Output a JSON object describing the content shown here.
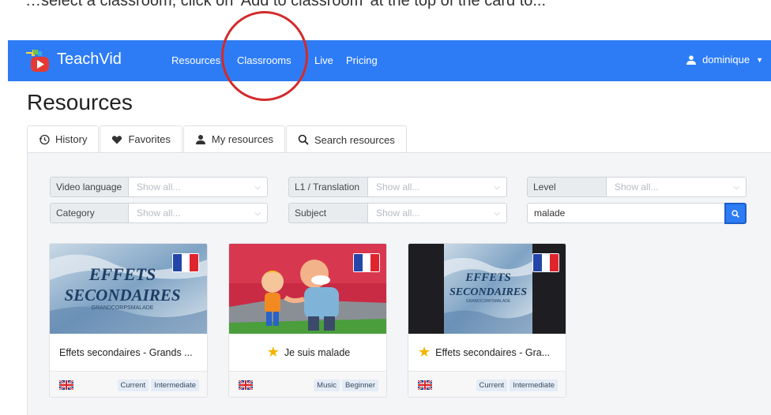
{
  "caption": "…select a classroom, click on 'Add to classroom' at the top of the card to...",
  "app": {
    "name": "TeachVid"
  },
  "nav": {
    "links": [
      "Resources",
      "Classrooms",
      "Live",
      "Pricing"
    ],
    "user": "dominique"
  },
  "page": {
    "title": "Resources"
  },
  "tabs": [
    "History",
    "Favorites",
    "My resources",
    "Search resources"
  ],
  "filters": {
    "video_language": {
      "label": "Video language",
      "value": "Show all..."
    },
    "translation": {
      "label": "L1 / Translation",
      "value": "Show all..."
    },
    "level": {
      "label": "Level",
      "value": "Show all..."
    },
    "category": {
      "label": "Category",
      "value": "Show all..."
    },
    "subject": {
      "label": "Subject",
      "value": "Show all..."
    },
    "search": {
      "value": "malade"
    }
  },
  "cards": [
    {
      "title": "Effets secondaires - Grands ...",
      "thumb_text": [
        "EFFETS",
        "SECONDAIRES",
        "GRANDCORPSMALADE"
      ],
      "tags": [
        "Current",
        "Intermediate"
      ],
      "favorite": false
    },
    {
      "title": "Je suis malade",
      "tags": [
        "Music",
        "Beginner"
      ],
      "favorite": true
    },
    {
      "title": "Effets secondaires - Gra...",
      "thumb_text": [
        "EFFETS",
        "SECONDAIRES",
        "GRANDCORPSMALADE"
      ],
      "tags": [
        "Current",
        "Intermediate"
      ],
      "favorite": true
    }
  ],
  "colors": {
    "primary": "#2d7cf6",
    "highlight": "#d32a2a",
    "star": "#f4b400"
  },
  "icons": {
    "history": "history-icon",
    "favorites": "heart-icon",
    "my_resources": "person-icon",
    "search": "search-icon"
  }
}
